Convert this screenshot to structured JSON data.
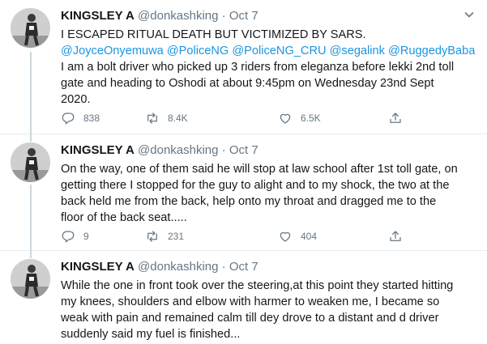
{
  "tweets": [
    {
      "name": "KINGSLEY A",
      "handle": "@donkashking",
      "separator": "·",
      "time": "Oct 7",
      "lines": [
        "I ESCAPED RITUAL DEATH BUT VICTIMIZED BY SARS."
      ],
      "mentions": [
        "@JoyceOnyemuwa",
        "@PoliceNG",
        "@PoliceNG_CRU",
        "@segalink",
        "@RuggedyBaba"
      ],
      "lines_after": [
        "I am a bolt driver who picked up 3 riders from eleganza before lekki 2nd toll",
        "gate and heading to Oshodi at about 9:45pm on Wednesday 23nd Sept",
        "2020."
      ],
      "replies": "838",
      "retweets": "8.4K",
      "likes": "6.5K"
    },
    {
      "name": "KINGSLEY A",
      "handle": "@donkashking",
      "separator": "·",
      "time": "Oct 7",
      "lines": [
        "On the way, one of them said he will stop at law school after 1st toll gate, on",
        "getting there I stopped for the guy to alight and to my shock, the two at the",
        "back held me from the back, help onto my throat and dragged me to the",
        "floor of the back seat....."
      ],
      "replies": "9",
      "retweets": "231",
      "likes": "404"
    },
    {
      "name": "KINGSLEY A",
      "handle": "@donkashking",
      "separator": "·",
      "time": "Oct 7",
      "lines": [
        "While the one in front took over the steering,at this point they started hitting",
        "my knees, shoulders and elbow with harmer to weaken me, I became so",
        "weak with pain and remained calm till dey drove to a distant and d driver",
        "suddenly said my fuel is finished..."
      ]
    }
  ],
  "colors": {
    "accent": "#1b95e0",
    "secondary_text": "#657786",
    "divider": "#e6ecf0"
  },
  "icons": [
    "reply-icon",
    "retweet-icon",
    "like-icon",
    "share-icon",
    "caret-down-icon"
  ]
}
